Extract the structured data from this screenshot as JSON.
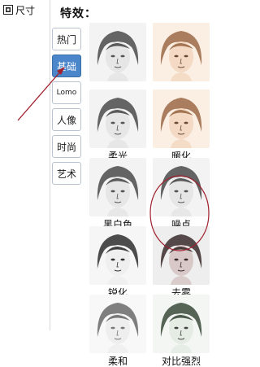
{
  "toolbar": {
    "size_label": "尺寸"
  },
  "panel": {
    "title": "特效："
  },
  "tabs": [
    {
      "label": "热门",
      "active": false
    },
    {
      "label": "基础",
      "active": true
    },
    {
      "label": "Lomo",
      "active": false
    },
    {
      "label": "人像",
      "active": false
    },
    {
      "label": "时尚",
      "active": false
    },
    {
      "label": "艺术",
      "active": false
    }
  ],
  "effects": [
    {
      "label": "",
      "tone": "bw"
    },
    {
      "label": "",
      "tone": "warm"
    },
    {
      "label": "柔光",
      "tone": "bw"
    },
    {
      "label": "暖化",
      "tone": "warm"
    },
    {
      "label": "黑白色",
      "tone": "bw"
    },
    {
      "label": "噪点",
      "tone": "bw"
    },
    {
      "label": "锐化",
      "tone": "sharp"
    },
    {
      "label": "去雾",
      "tone": "dark"
    },
    {
      "label": "柔和",
      "tone": "soft"
    },
    {
      "label": "对比强烈",
      "tone": "contrast"
    }
  ],
  "colors": {
    "accent": "#4a86c9",
    "annotation": "#a0202e"
  },
  "icons": {
    "size": "crop-icon"
  }
}
